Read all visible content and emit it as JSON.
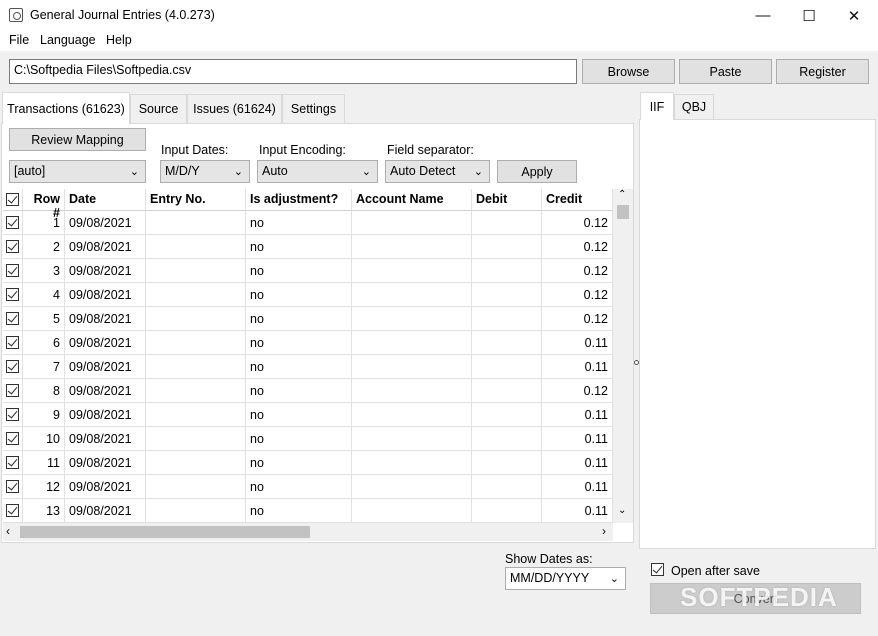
{
  "window": {
    "title": "General Journal Entries (4.0.273)",
    "minimize": "—",
    "maximize": "☐",
    "close": "✕"
  },
  "menu": [
    "File",
    "Language",
    "Help"
  ],
  "path": {
    "value": "C:\\Softpedia Files\\Softpedia.csv",
    "browse_label": "Browse",
    "paste_label": "Paste",
    "register_label": "Register"
  },
  "tabs": [
    {
      "label": "Transactions (61623)",
      "active": true
    },
    {
      "label": "Source"
    },
    {
      "label": "Issues (61624)"
    },
    {
      "label": "Settings"
    }
  ],
  "controls": {
    "review_mapping_label": "Review Mapping",
    "mapping_value": "[auto]",
    "input_dates_label": "Input Dates:",
    "input_dates_value": "M/D/Y",
    "input_encoding_label": "Input Encoding:",
    "input_encoding_value": "Auto",
    "field_separator_label": "Field separator:",
    "field_separator_value": "Auto Detect",
    "apply_label": "Apply"
  },
  "grid": {
    "columns": [
      "Row #",
      "Date",
      "Entry No.",
      "Is adjustment?",
      "Account Name",
      "Debit",
      "Credit"
    ],
    "rows": [
      {
        "row": "1",
        "date": "09/08/2021",
        "entry": "",
        "adj": "no",
        "account": "",
        "debit": "",
        "credit": "0.12"
      },
      {
        "row": "2",
        "date": "09/08/2021",
        "entry": "",
        "adj": "no",
        "account": "",
        "debit": "",
        "credit": "0.12"
      },
      {
        "row": "3",
        "date": "09/08/2021",
        "entry": "",
        "adj": "no",
        "account": "",
        "debit": "",
        "credit": "0.12"
      },
      {
        "row": "4",
        "date": "09/08/2021",
        "entry": "",
        "adj": "no",
        "account": "",
        "debit": "",
        "credit": "0.12"
      },
      {
        "row": "5",
        "date": "09/08/2021",
        "entry": "",
        "adj": "no",
        "account": "",
        "debit": "",
        "credit": "0.12"
      },
      {
        "row": "6",
        "date": "09/08/2021",
        "entry": "",
        "adj": "no",
        "account": "",
        "debit": "",
        "credit": "0.11"
      },
      {
        "row": "7",
        "date": "09/08/2021",
        "entry": "",
        "adj": "no",
        "account": "",
        "debit": "",
        "credit": "0.11"
      },
      {
        "row": "8",
        "date": "09/08/2021",
        "entry": "",
        "adj": "no",
        "account": "",
        "debit": "",
        "credit": "0.12"
      },
      {
        "row": "9",
        "date": "09/08/2021",
        "entry": "",
        "adj": "no",
        "account": "",
        "debit": "",
        "credit": "0.11"
      },
      {
        "row": "10",
        "date": "09/08/2021",
        "entry": "",
        "adj": "no",
        "account": "",
        "debit": "",
        "credit": "0.11"
      },
      {
        "row": "11",
        "date": "09/08/2021",
        "entry": "",
        "adj": "no",
        "account": "",
        "debit": "",
        "credit": "0.11"
      },
      {
        "row": "12",
        "date": "09/08/2021",
        "entry": "",
        "adj": "no",
        "account": "",
        "debit": "",
        "credit": "0.11"
      },
      {
        "row": "13",
        "date": "09/08/2021",
        "entry": "",
        "adj": "no",
        "account": "",
        "debit": "",
        "credit": "0.11"
      }
    ]
  },
  "show_dates": {
    "label": "Show Dates as:",
    "value": "MM/DD/YYYY"
  },
  "right_tabs": [
    {
      "label": "IIF",
      "active": true
    },
    {
      "label": "QBJ"
    }
  ],
  "output": {
    "open_after_save_label": "Open after save",
    "open_after_save_checked": true,
    "convert_label": "Convert"
  },
  "watermark": "SOFTPEDIA",
  "icons": {
    "chevron": "chevron-down-icon",
    "checkbox": "checkbox-checked-icon"
  }
}
